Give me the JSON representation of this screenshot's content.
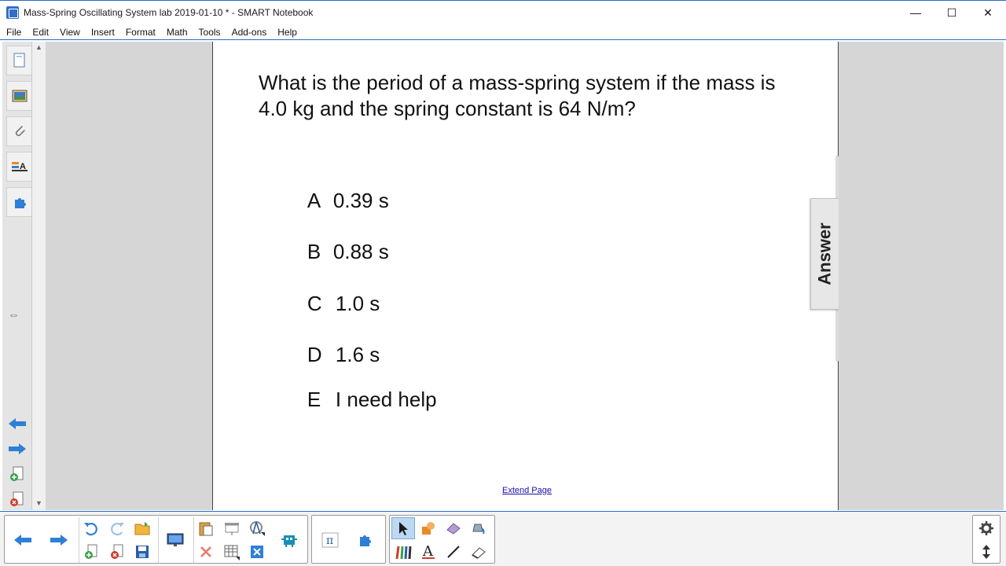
{
  "window": {
    "title": "Mass-Spring Oscillating System lab 2019-01-10 * - SMART Notebook",
    "minimize": "—",
    "maximize": "☐",
    "close": "✕"
  },
  "menu": {
    "items": [
      {
        "label": "File"
      },
      {
        "label": "Edit"
      },
      {
        "label": "View"
      },
      {
        "label": "Insert"
      },
      {
        "label": "Format"
      },
      {
        "label": "Math"
      },
      {
        "label": "Tools"
      },
      {
        "label": "Add-ons"
      },
      {
        "label": "Help"
      }
    ]
  },
  "side_tabs": [
    "page-sorter-icon",
    "gallery-icon",
    "attachments-icon",
    "properties-icon",
    "add-ons-icon"
  ],
  "page": {
    "question": "What is the period of a mass-spring system if the mass is 4.0 kg and the spring constant is 64 N/m?",
    "options": [
      {
        "letter": "A",
        "text": "0.39 s"
      },
      {
        "letter": "B",
        "text": "0.88 s"
      },
      {
        "letter": "C",
        "text": "1.0 s"
      },
      {
        "letter": "D",
        "text": "1.6 s"
      },
      {
        "letter": "E",
        "text": "I need help"
      }
    ],
    "answer_tab": "Answer",
    "extend_link": "Extend Page"
  },
  "colors": {
    "accent": "#2b6cc4",
    "arrow_blue": "#2f7fd6",
    "orange": "#e98a25",
    "red": "#d23b2b",
    "green": "#3aa04a"
  }
}
